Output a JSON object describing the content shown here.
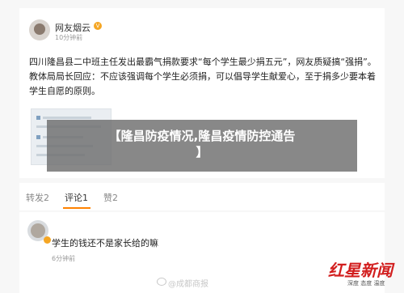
{
  "post": {
    "author": "网友烟云",
    "time": "10分钟前",
    "body": "四川隆昌县二中班主任发出最霸气捐款要求“每个学生最少捐五元”，网友质疑搞“强捐”。教体局局长回应：不应该强调每个学生必须捐，可以倡导学生献爱心，至于捐多少要本着学生自愿的原则。"
  },
  "banner": {
    "line1": "【隆昌防疫情况,隆昌疫情防控通告",
    "line2": "】"
  },
  "actions": {
    "repost": "转发2",
    "comment": "评论1",
    "like": "赞2"
  },
  "comment": {
    "text": "学生的钱还不是家长给的嘛",
    "time": "6分钟前"
  },
  "watermark": {
    "text": "@成都商报"
  },
  "logo": {
    "main": "红星新闻",
    "sub": "深度 态度 温度"
  },
  "colors": {
    "accent": "#ff8200",
    "logo_red": "#d21e1e",
    "badge": "#f5a623"
  }
}
